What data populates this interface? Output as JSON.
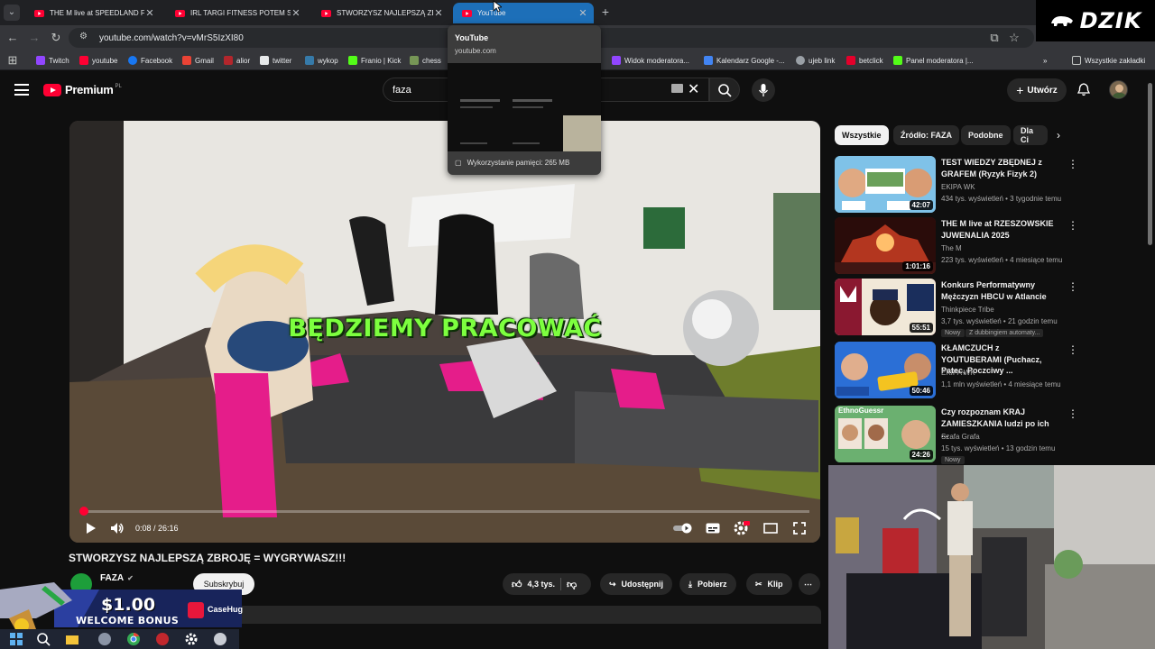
{
  "browser": {
    "tabs": [
      {
        "title": "THE M live at SPEEDLAND FEST",
        "active": false
      },
      {
        "title": "IRL TARGI FITNESS POTEM SPO",
        "active": false
      },
      {
        "title": "STWORZYSZ NAJLEPSZĄ ZBRO",
        "active": false
      },
      {
        "title": "YouTube",
        "active": true
      }
    ],
    "url": "youtube.com/watch?v=vMrS5IzXI80",
    "bookmarks": [
      {
        "label": "Twitch",
        "color": "#9146ff"
      },
      {
        "label": "youtube",
        "color": "#ff0033"
      },
      {
        "label": "Facebook",
        "color": "#1877f2"
      },
      {
        "label": "Gmail",
        "color": "#ea4335"
      },
      {
        "label": "alior",
        "color": "#b3262c"
      },
      {
        "label": "twitter",
        "color": "#e7e9ea"
      },
      {
        "label": "wykop",
        "color": "#367aa9"
      },
      {
        "label": "Franio | Kick",
        "color": "#53fc18"
      },
      {
        "label": "chess",
        "color": "#769656"
      },
      {
        "label": "Widok moderatora...",
        "color": "#9146ff"
      },
      {
        "label": "Kalendarz Google -...",
        "color": "#4285f4"
      },
      {
        "label": "ujeb link",
        "color": "#9aa0a6"
      },
      {
        "label": "betclick",
        "color": "#e4002b"
      },
      {
        "label": "Panel moderatora |...",
        "color": "#53fc18"
      }
    ],
    "all_bookmarks": "Wszystkie zakładki"
  },
  "hover_card": {
    "title": "YouTube",
    "domain": "youtube.com",
    "memory": "Wykorzystanie pamięci: 265 MB"
  },
  "overlay_brand": "DZIK",
  "youtube": {
    "logo_word": "Premium",
    "logo_region": "PL",
    "search_query": "faza",
    "create_label": "Utwórz"
  },
  "player": {
    "caption": "BĘDZIEMY PRACOWAĆ",
    "time": "0:08 / 26:16",
    "progress_fraction": 0.005,
    "video_title": "STWORZYSZ NAJLEPSZĄ ZBROJĘ = WYGRYWASZ!!!",
    "channel": "FAZA",
    "subscribe": "Subskrybuj",
    "likes": "4,3 tys.",
    "share": "Udostępnij",
    "download": "Pobierz",
    "clip": "Klip"
  },
  "chips": [
    "Wszystkie",
    "Źródło: FAZA",
    "Podobne",
    "Dla Ci"
  ],
  "recommendations": [
    {
      "title": "TEST WIEDZY ZBĘDNEJ z GRAFEM (Ryzyk Fizyk 2)",
      "channel": "EKIPA WK",
      "meta": "434 tys. wyświetleń • 3 tygodnie temu",
      "duration": "42:07",
      "thumb_color": "#5aa7d6"
    },
    {
      "title": "THE M live at RZESZOWSKIE JUWENALIA 2025",
      "channel": "The M",
      "meta": "223 tys. wyświetleń • 4 miesiące temu",
      "duration": "1:01:16",
      "thumb_color": "#7a1a14"
    },
    {
      "title": "Konkurs Performatywny Mężczyzn HBCU w Atlancie",
      "channel": "Thinkpiece Tribe",
      "meta": "3,7 tys. wyświetleń • 21 godzin temu",
      "duration": "55:51",
      "thumb_color": "#8a1830",
      "badge": "Nowy",
      "badge2": "Z dubbingiem automaty..."
    },
    {
      "title": "KŁAMCZUCH z YOUTUBERAMI (Puchacz, Patec, Poczciwy ...",
      "channel": "EKIPA WK",
      "meta": "1,1 mln wyświetleń • 4 miesiące temu",
      "duration": "50:46",
      "thumb_color": "#2b6fd6"
    },
    {
      "title": "Czy rozpoznam KRAJ ZAMIESZKANIA ludzi po ich ...",
      "channel": "Szafa Grafa",
      "meta": "15 tys. wyświetleń • 13 godzin temu",
      "duration": "24:26",
      "thumb_color": "#3f8a56",
      "badge": "Nowy",
      "thumb_label": "EthnoGuessr"
    }
  ],
  "casino_overlay": {
    "amount": "$1.00",
    "bonus": "WELCOME BONUS",
    "brand": "CaseHug"
  }
}
